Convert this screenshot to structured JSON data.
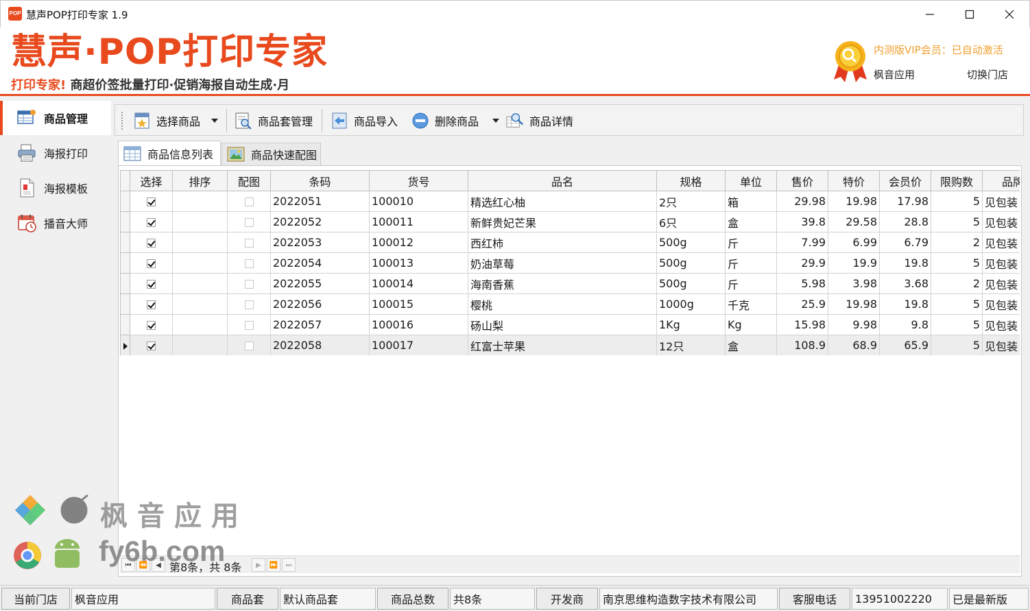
{
  "window": {
    "title": "慧声POP打印专家 1.9",
    "app_icon_text": "POP"
  },
  "banner": {
    "logo_main": "慧声·POP打印专家",
    "logo_sub_red": "打印专家!",
    "logo_sub_rest": " 商超价签批量打印·促销海报自动生成·月",
    "vip_text": "内测版VIP会员：已自动激活",
    "user_name": "枫音应用",
    "switch_store": "切换门店"
  },
  "sidebar": {
    "items": [
      {
        "label": "商品管理",
        "icon": "product-manage-icon",
        "active": true
      },
      {
        "label": "海报打印",
        "icon": "printer-icon",
        "active": false
      },
      {
        "label": "海报模板",
        "icon": "template-icon",
        "active": false
      },
      {
        "label": "播音大师",
        "icon": "calendar-clock-icon",
        "active": false
      }
    ]
  },
  "toolbar": {
    "select_product": "选择商品",
    "product_set": "商品套管理",
    "import_product": "商品导入",
    "delete_product": "删除商品",
    "product_detail": "商品详情"
  },
  "tabs": {
    "list": "商品信息列表",
    "quick_image": "商品快速配图"
  },
  "table": {
    "headers": [
      "选择",
      "排序",
      "配图",
      "条码",
      "货号",
      "品名",
      "规格",
      "单位",
      "售价",
      "特价",
      "会员价",
      "限购数",
      "品牌"
    ],
    "rows": [
      {
        "checked": true,
        "order": "",
        "image": false,
        "barcode": "2022051",
        "sku": "100010",
        "name": "精选红心柚",
        "spec": "2只",
        "unit": "箱",
        "price": "29.98",
        "special": "19.98",
        "member": "17.98",
        "limit": "5",
        "brand": "见包装"
      },
      {
        "checked": true,
        "order": "",
        "image": false,
        "barcode": "2022052",
        "sku": "100011",
        "name": "新鲜贵妃芒果",
        "spec": "6只",
        "unit": "盒",
        "price": "39.8",
        "special": "29.58",
        "member": "28.8",
        "limit": "5",
        "brand": "见包装"
      },
      {
        "checked": true,
        "order": "",
        "image": false,
        "barcode": "2022053",
        "sku": "100012",
        "name": "西红柿",
        "spec": "500g",
        "unit": "斤",
        "price": "7.99",
        "special": "6.99",
        "member": "6.79",
        "limit": "2",
        "brand": "见包装"
      },
      {
        "checked": true,
        "order": "",
        "image": false,
        "barcode": "2022054",
        "sku": "100013",
        "name": "奶油草莓",
        "spec": "500g",
        "unit": "斤",
        "price": "29.9",
        "special": "19.9",
        "member": "19.8",
        "limit": "5",
        "brand": "见包装"
      },
      {
        "checked": true,
        "order": "",
        "image": false,
        "barcode": "2022055",
        "sku": "100014",
        "name": "海南香蕉",
        "spec": "500g",
        "unit": "斤",
        "price": "5.98",
        "special": "3.98",
        "member": "3.68",
        "limit": "2",
        "brand": "见包装"
      },
      {
        "checked": true,
        "order": "",
        "image": false,
        "barcode": "2022056",
        "sku": "100015",
        "name": "樱桃",
        "spec": "1000g",
        "unit": "千克",
        "price": "25.9",
        "special": "19.98",
        "member": "19.8",
        "limit": "5",
        "brand": "见包装"
      },
      {
        "checked": true,
        "order": "",
        "image": false,
        "barcode": "2022057",
        "sku": "100016",
        "name": "砀山梨",
        "spec": "1Kg",
        "unit": "Kg",
        "price": "15.98",
        "special": "9.98",
        "member": "9.8",
        "limit": "5",
        "brand": "见包装"
      },
      {
        "checked": true,
        "order": "",
        "image": false,
        "barcode": "2022058",
        "sku": "100017",
        "name": "红富士苹果",
        "spec": "12只",
        "unit": "盒",
        "price": "108.9",
        "special": "68.9",
        "member": "65.9",
        "limit": "5",
        "brand": "见包装",
        "current": true
      }
    ]
  },
  "pager": {
    "text": "第8条，共 8条"
  },
  "statusbar": {
    "store_label": "当前门店",
    "store_value": "枫音应用",
    "set_label": "商品套",
    "set_value": "默认商品套",
    "count_label": "商品总数",
    "count_value": "共8条",
    "dev_label": "开发商",
    "dev_value": "南京思维构造数字技术有限公司",
    "phone_label": "客服电话",
    "phone_value": "13951002220",
    "version_status": "已是最新版"
  },
  "watermark": {
    "cn": "枫音应用",
    "en": "fy6b.com"
  },
  "colors": {
    "brand_orange": "#e8491d",
    "vip_gold": "#f0a030"
  }
}
